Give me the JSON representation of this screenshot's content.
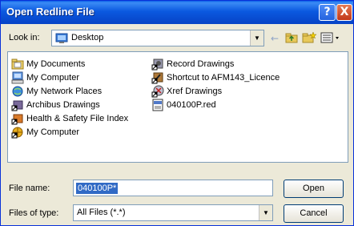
{
  "window": {
    "title": "Open Redline File"
  },
  "titlebar": {
    "help": "?",
    "close": "X"
  },
  "lookin": {
    "label": "Look in:",
    "value": "Desktop"
  },
  "files": {
    "left": [
      {
        "label": "My Documents",
        "icon": "my-documents-icon"
      },
      {
        "label": "My Computer",
        "icon": "my-computer-icon"
      },
      {
        "label": "My Network Places",
        "icon": "network-places-icon"
      },
      {
        "label": "Archibus Drawings",
        "icon": "folder-shortcut-icon"
      },
      {
        "label": "Health & Safety File Index",
        "icon": "folder-shortcut-icon"
      },
      {
        "label": "My Computer",
        "icon": "my-computer-shortcut-icon"
      }
    ],
    "right": [
      {
        "label": "Record Drawings",
        "icon": "folder-shortcut-icon"
      },
      {
        "label": "Shortcut to AFM143_Licence",
        "icon": "folder-shortcut-icon"
      },
      {
        "label": "Xref Drawings",
        "icon": "folder-shortcut-icon"
      },
      {
        "label": "040100P.red",
        "icon": "red-file-icon"
      }
    ]
  },
  "filename": {
    "label": "File name:",
    "value": "040100P*"
  },
  "filetype": {
    "label": "Files of type:",
    "value": "All Files (*.*)"
  },
  "buttons": {
    "open": "Open",
    "cancel": "Cancel"
  },
  "colors": {
    "title_bar": "#0b59e0",
    "selection": "#316ac5",
    "face": "#ece9d8"
  }
}
